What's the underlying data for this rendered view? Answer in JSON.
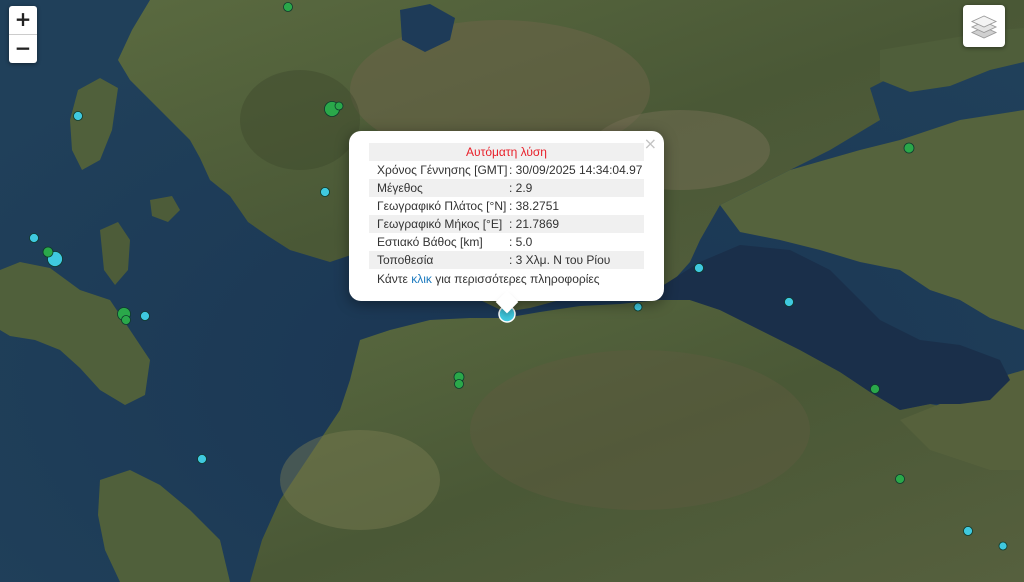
{
  "zoom": {
    "in_label": "+",
    "out_label": "−"
  },
  "layers_control": {
    "icon": "layers-icon"
  },
  "popup": {
    "close_label": "×",
    "title": "Αυτόματη λύση",
    "title_color": "#e8202a",
    "rows": [
      {
        "label": "Χρόνος Γέννησης [GMT]",
        "value": ": 30/09/2025 14:34:04.97"
      },
      {
        "label": "Μέγεθος",
        "value": ": 2.9"
      },
      {
        "label": "Γεωγραφικό Πλάτος [°N]",
        "value": ": 38.2751"
      },
      {
        "label": "Γεωγραφικό Μήκος [°E]",
        "value": ": 21.7869"
      },
      {
        "label": "Εστιακό Βάθος [km]",
        "value": ": 5.0"
      },
      {
        "label": "Τοποθεσία",
        "value": ": 3 Χλμ. Ν του Ρίου"
      }
    ],
    "footer_prefix": "Κάντε ",
    "footer_link": "κλικ",
    "footer_suffix": " για περισσότερες πληροφορίες"
  },
  "colors": {
    "sea": "#1c3650",
    "land": "#4b5a38",
    "mountain": "#6a6046",
    "marker_recent": "#3fc9df",
    "marker_older": "#2aa84a",
    "link": "#1e7bbf"
  },
  "markers": [
    {
      "category": "selected"
    },
    {
      "category": "recent"
    },
    {
      "category": "recent"
    },
    {
      "category": "recent"
    },
    {
      "category": "recent"
    },
    {
      "category": "recent"
    },
    {
      "category": "recent"
    },
    {
      "category": "recent"
    },
    {
      "category": "recent"
    },
    {
      "category": "recent"
    },
    {
      "category": "recent"
    },
    {
      "category": "recent"
    },
    {
      "category": "older"
    },
    {
      "category": "older"
    },
    {
      "category": "older"
    },
    {
      "category": "older"
    },
    {
      "category": "older"
    },
    {
      "category": "older"
    },
    {
      "category": "older"
    },
    {
      "category": "older"
    },
    {
      "category": "older"
    },
    {
      "category": "older"
    },
    {
      "category": "older"
    }
  ]
}
